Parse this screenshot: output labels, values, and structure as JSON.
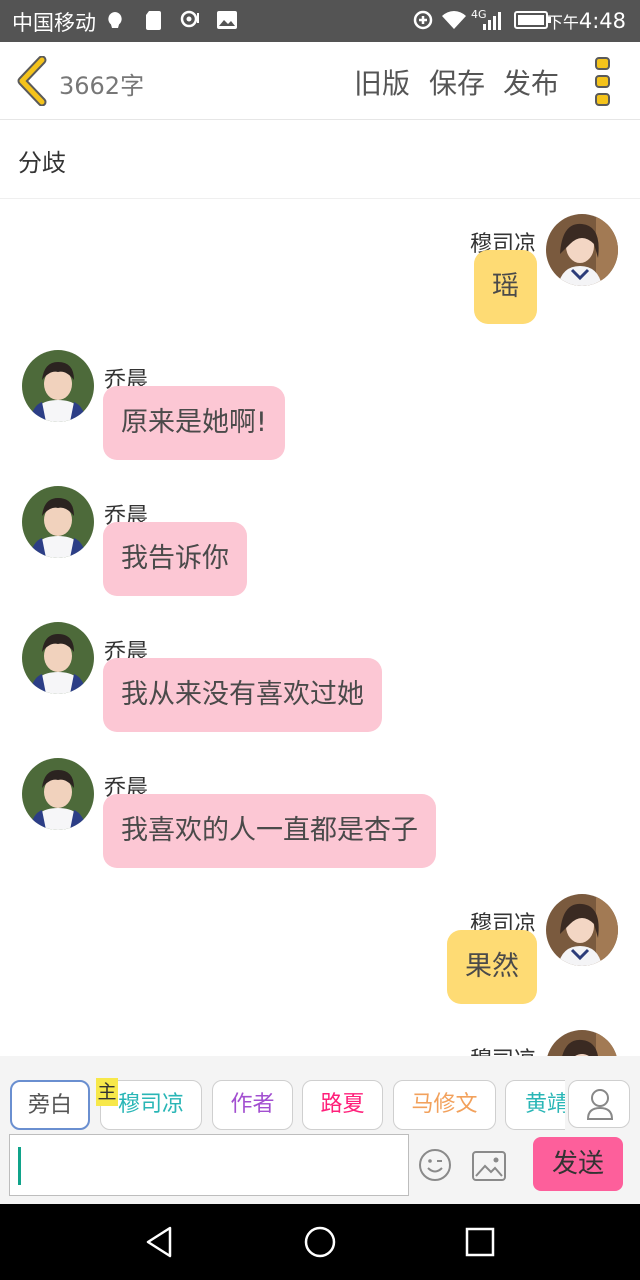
{
  "status_bar": {
    "carrier": "中国移动",
    "network": "4G",
    "time_prefix": "下午",
    "time": "4:48"
  },
  "header": {
    "word_count": "3662字",
    "old_version_label": "旧版",
    "save_label": "保存",
    "publish_label": "发布",
    "accent_color": "#f4c31b"
  },
  "chapter": {
    "title": "分歧"
  },
  "messages": [
    {
      "side": "right",
      "sender": "穆司凉",
      "text": "瑶"
    },
    {
      "side": "left",
      "sender": "乔晨",
      "text": "原来是她啊!"
    },
    {
      "side": "left",
      "sender": "乔晨",
      "text": "我告诉你"
    },
    {
      "side": "left",
      "sender": "乔晨",
      "text": "我从来没有喜欢过她"
    },
    {
      "side": "left",
      "sender": "乔晨",
      "text": "我喜欢的人一直都是杏子"
    },
    {
      "side": "right",
      "sender": "穆司凉",
      "text": "果然"
    },
    {
      "side": "right",
      "sender": "穆司凉",
      "text": ""
    }
  ],
  "characters": {
    "main_tag": "主",
    "items": [
      {
        "label": "旁白",
        "color": "#555555",
        "selected": true
      },
      {
        "label": "穆司凉",
        "color": "#29b6b6",
        "selected": false
      },
      {
        "label": "作者",
        "color": "#a24fd0",
        "selected": false
      },
      {
        "label": "路夏",
        "color": "#ff1f7a",
        "selected": false
      },
      {
        "label": "马修文",
        "color": "#f2a15c",
        "selected": false
      },
      {
        "label": "黄靖",
        "color": "#29b6b6",
        "selected": false
      }
    ]
  },
  "input": {
    "value": "",
    "send_label": "发送",
    "send_color": "#fd5f9b"
  },
  "bubble_colors": {
    "left": "#fcc7d4",
    "right": "#fedb74"
  }
}
